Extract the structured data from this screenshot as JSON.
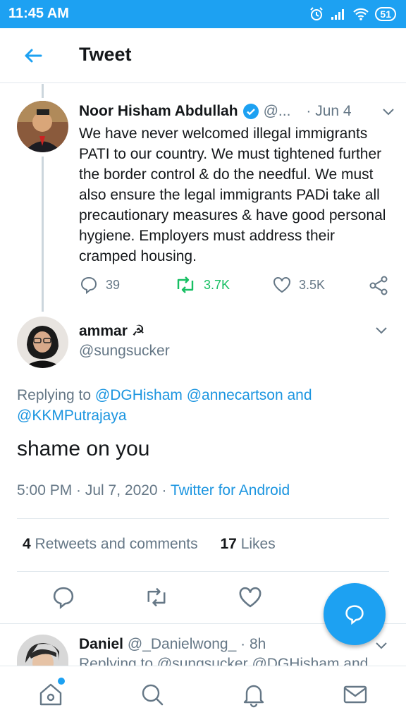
{
  "status_bar": {
    "time": "11:45 AM",
    "battery": "51"
  },
  "app_bar": {
    "title": "Tweet"
  },
  "parent_tweet": {
    "name": "Noor Hisham Abdullah",
    "handle": "@...",
    "date": "· Jun 4",
    "text": "We have never welcomed illegal immigrants PATI to our country. We must tightened further the border control & do the needful. We must also ensure the legal immigrants PADi take all precautionary measures & have good personal hygiene. Employers must address their cramped housing.",
    "replies": "39",
    "retweets": "3.7K",
    "likes": "3.5K"
  },
  "main_tweet": {
    "name": "ammar ☭",
    "handle": "@sungsucker",
    "replying_prefix": "Replying to",
    "replying_to": "@DGHisham @annecartson",
    "replying_and": "and",
    "replying_last": "@KKMPutrajaya",
    "text": "shame on you",
    "time": "5:00 PM · Jul 7, 2020 ·",
    "source": "Twitter for Android",
    "retweets_count": "4",
    "retweets_label": "Retweets and comments",
    "likes_count": "17",
    "likes_label": "Likes"
  },
  "next_reply": {
    "name": "Daniel",
    "handle": "@_Danielwong_",
    "time": "· 8h",
    "replying": "Replying to @sungsucker @DGHisham and"
  },
  "colors": {
    "accent": "#1da1f2",
    "retweet_green": "#17bf63",
    "muted": "#657786"
  },
  "icons": [
    "back-arrow-icon",
    "verified-icon",
    "chevron-down-icon",
    "reply-icon",
    "retweet-icon",
    "like-icon",
    "share-icon",
    "compose-reply-icon",
    "home-icon",
    "search-icon",
    "notifications-icon",
    "messages-icon"
  ]
}
